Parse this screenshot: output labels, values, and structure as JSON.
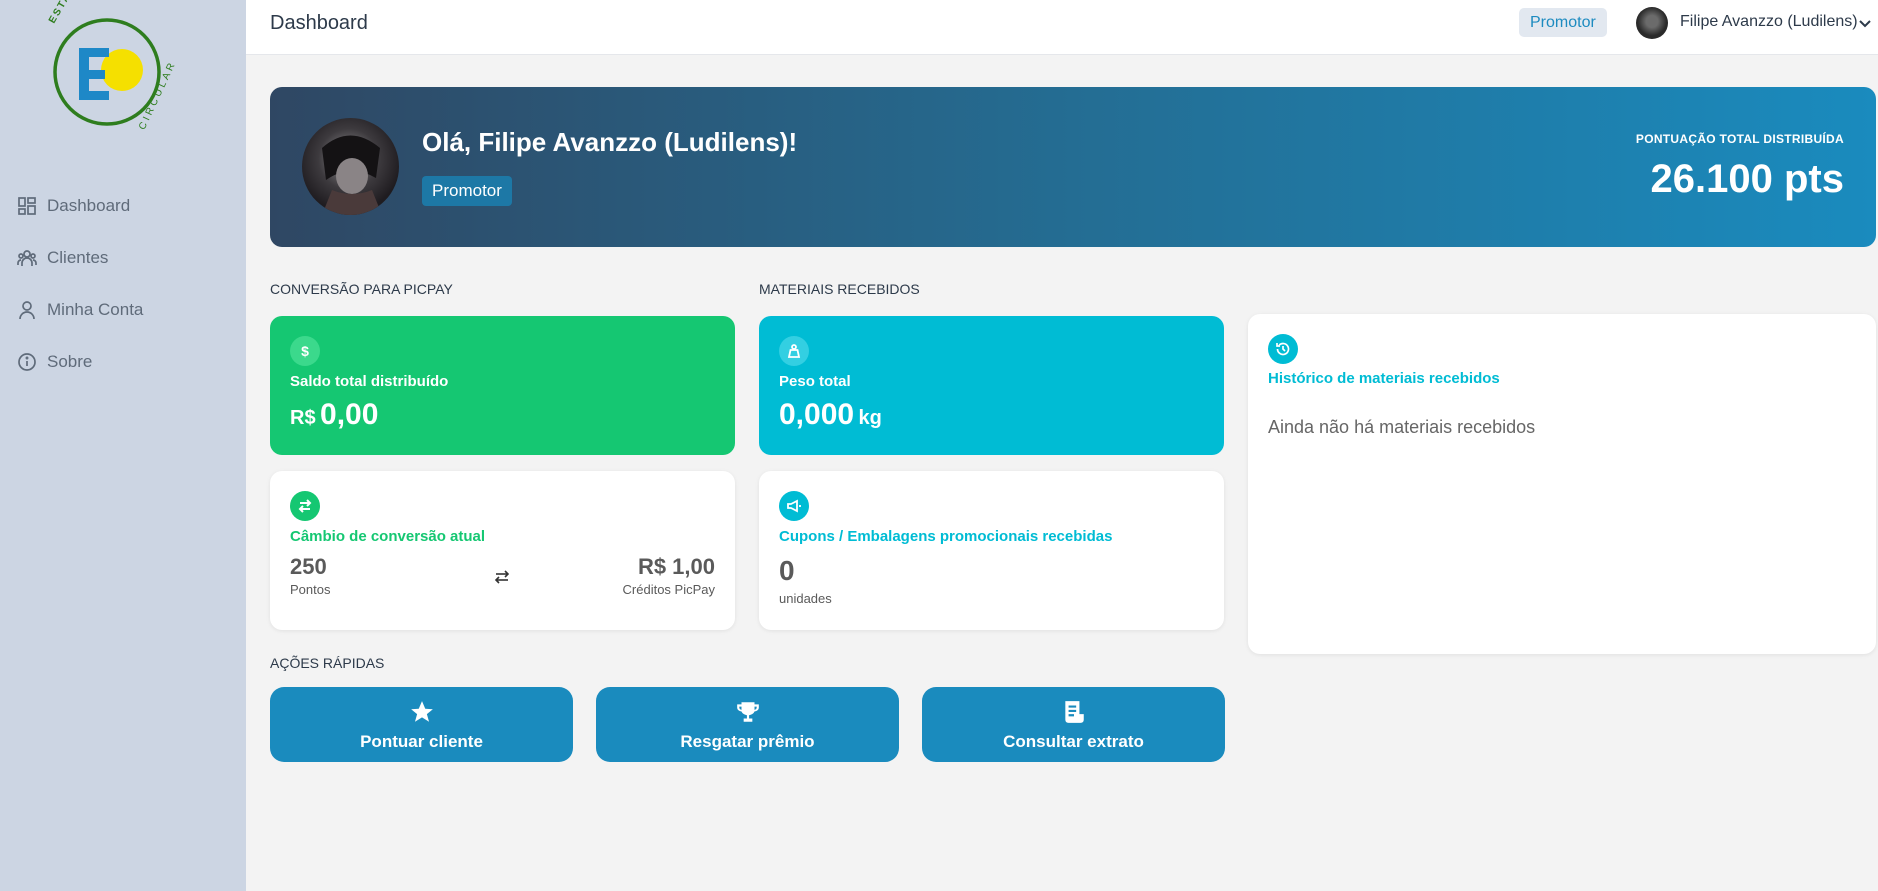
{
  "app": {
    "logo_text_top": "ESTAÇÃO",
    "logo_text_bottom": "CIRCULAR",
    "logo_letter": "E"
  },
  "sidebar": {
    "items": [
      {
        "label": "Dashboard",
        "icon": "dashboard-grid-icon"
      },
      {
        "label": "Clientes",
        "icon": "users-icon"
      },
      {
        "label": "Minha Conta",
        "icon": "user-icon"
      },
      {
        "label": "Sobre",
        "icon": "info-icon"
      }
    ]
  },
  "header": {
    "title": "Dashboard",
    "role_badge": "Promotor",
    "user_name": "Filipe Avanzzo (Ludilens)"
  },
  "hero": {
    "greeting": "Olá, Filipe Avanzzo (Ludilens)!",
    "role": "Promotor",
    "score_label": "PONTUAÇÃO TOTAL DISTRIBUÍDA",
    "score_value": "26.100 pts"
  },
  "sections": {
    "picpay": "CONVERSÃO PARA PICPAY",
    "materials": "MATERIAIS RECEBIDOS",
    "quick_actions": "AÇÕES RÁPIDAS"
  },
  "cards": {
    "balance": {
      "label": "Saldo total distribuído",
      "currency": "R$",
      "value": "0,00"
    },
    "exchange": {
      "label": "Câmbio de conversão atual",
      "left_value": "250",
      "left_unit": "Pontos",
      "right_value": "R$ 1,00",
      "right_unit": "Créditos PicPay"
    },
    "weight": {
      "label": "Peso total",
      "value": "0,000",
      "unit": "kg"
    },
    "coupons": {
      "label": "Cupons / Embalagens promocionais recebidas",
      "value": "0",
      "unit": "unidades"
    },
    "history": {
      "label": "Histórico de materiais recebidos",
      "empty_text": "Ainda não há materiais recebidos"
    }
  },
  "actions": {
    "score_client": "Pontuar cliente",
    "redeem_prize": "Resgatar prêmio",
    "statement": "Consultar extrato"
  },
  "colors": {
    "green": "#15c772",
    "cyan": "#00bcd4",
    "blue": "#1a8bbe",
    "sidebar": "#ccd5e3"
  }
}
